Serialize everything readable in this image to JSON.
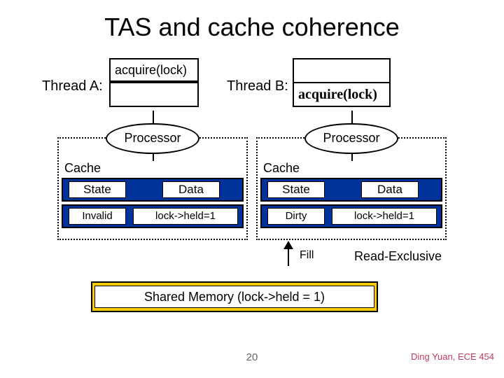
{
  "title": "TAS and cache coherence",
  "threads": {
    "a_label": "Thread A:",
    "b_label": "Thread B:",
    "a_call": "acquire(lock)",
    "b_call": "acquire(lock)"
  },
  "caches": {
    "processor_label": "Processor",
    "cache_label": "Cache",
    "col_state": "State",
    "col_data": "Data",
    "a_state": "Invalid",
    "a_data": "lock->held=1",
    "b_state": "Dirty",
    "b_data": "lock->held=1"
  },
  "annotations": {
    "fill": "Fill",
    "read_excl": "Read-Exclusive"
  },
  "memory": "Shared Memory (lock->held = 1)",
  "page_number": "20",
  "credit": "Ding Yuan, ECE 454"
}
